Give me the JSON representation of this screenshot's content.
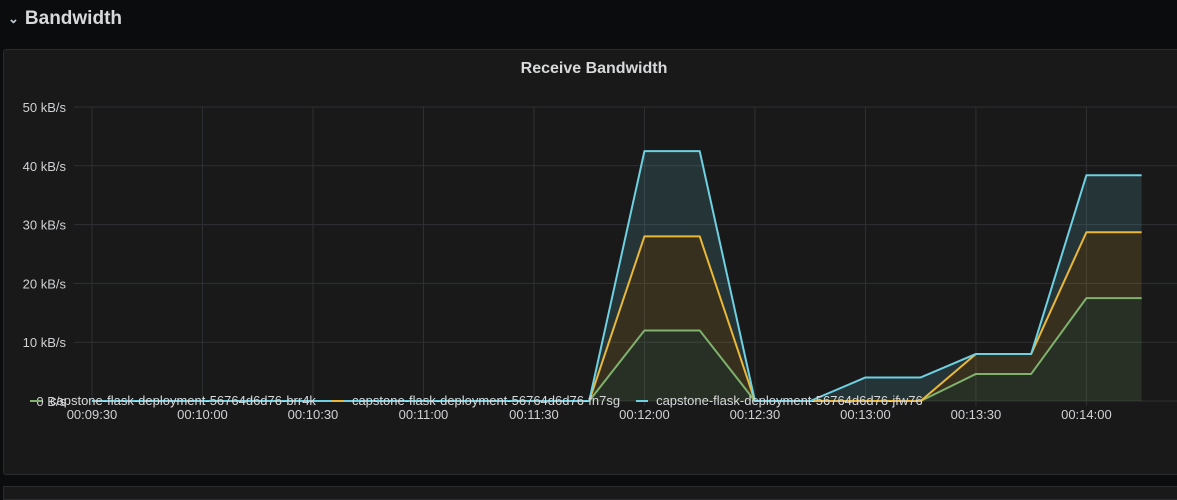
{
  "row": {
    "title": "Bandwidth",
    "icon": "chevron-down-icon"
  },
  "panel": {
    "title": "Receive Bandwidth"
  },
  "chart_data": {
    "type": "area",
    "stacked": true,
    "title": "Receive Bandwidth",
    "ylabel": "",
    "xlabel": "",
    "ylim": [
      0,
      50
    ],
    "y_ticks": [
      "0 B/s",
      "10 kB/s",
      "20 kB/s",
      "30 kB/s",
      "40 kB/s",
      "50 kB/s"
    ],
    "y_tick_values": [
      0,
      10,
      20,
      30,
      40,
      50
    ],
    "x_ticks": [
      "00:09:30",
      "00:10:00",
      "00:10:30",
      "00:11:00",
      "00:11:30",
      "00:12:00",
      "00:12:30",
      "00:13:00",
      "00:13:30",
      "00:14:00"
    ],
    "x": [
      "00:09:30",
      "00:09:45",
      "00:10:00",
      "00:10:15",
      "00:10:30",
      "00:10:45",
      "00:11:00",
      "00:11:15",
      "00:11:30",
      "00:11:45",
      "00:12:00",
      "00:12:15",
      "00:12:30",
      "00:12:45",
      "00:13:00",
      "00:13:15",
      "00:13:30",
      "00:13:45",
      "00:14:00",
      "00:14:15"
    ],
    "unit": "kB/s",
    "grid": true,
    "legend": "bottom",
    "series": [
      {
        "name": "capstone-flask-deployment-56764d6d76-brr4k",
        "color": "#7eb26d",
        "values": [
          0,
          0,
          0,
          0,
          0,
          0,
          0,
          0,
          0,
          0,
          12,
          12,
          0,
          0,
          0,
          0,
          4.6,
          4.6,
          17.5,
          17.5
        ]
      },
      {
        "name": "capstone-flask-deployment-56764d6d76-fn7sg",
        "color": "#eab839",
        "values": [
          0,
          0,
          0,
          0,
          0,
          0,
          0,
          0,
          0,
          0,
          16,
          16,
          0,
          0,
          0,
          0,
          3.4,
          3.4,
          11.2,
          11.2
        ]
      },
      {
        "name": "capstone-flask-deployment-56764d6d76-jfw76",
        "color": "#6ed0e0",
        "values": [
          0,
          0,
          0,
          0,
          0,
          0,
          0,
          0,
          0,
          0,
          14.5,
          14.5,
          0,
          0,
          4,
          4,
          0,
          0,
          9.7,
          9.7
        ]
      }
    ]
  }
}
